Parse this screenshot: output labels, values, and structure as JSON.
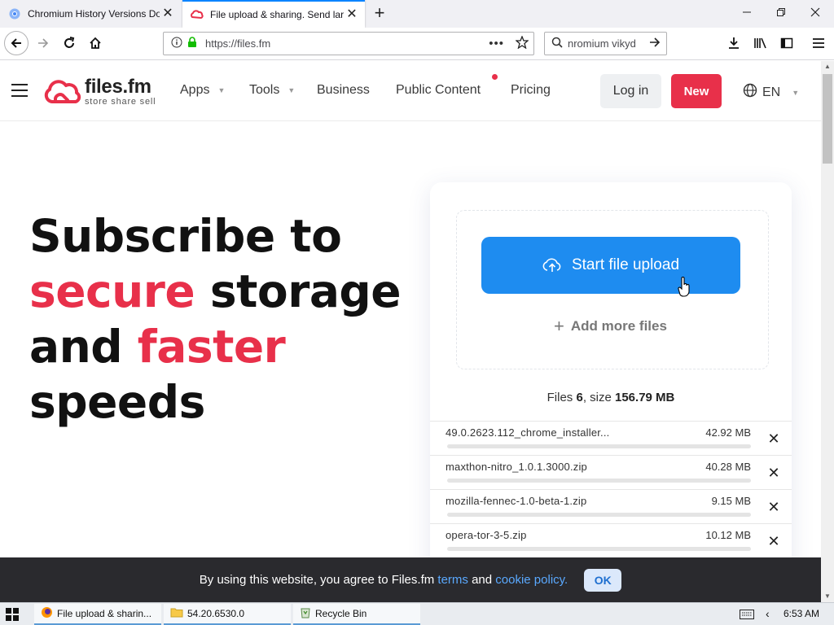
{
  "browser": {
    "tabs": [
      {
        "title": "Chromium History Versions Do"
      },
      {
        "title": "File upload & sharing. Send lar"
      }
    ],
    "url": "https://files.fm",
    "search_value": "nromium vikyd"
  },
  "site": {
    "logo_name": "files.fm",
    "logo_tagline": "store  share  sell",
    "nav": [
      {
        "label": "Apps"
      },
      {
        "label": "Tools"
      },
      {
        "label": "Business"
      },
      {
        "label": "Public Content"
      },
      {
        "label": "Pricing"
      }
    ],
    "login_label": "Log in",
    "new_label": "New",
    "language": "EN",
    "accent_color": "#e8304a",
    "primary_color": "#1e8cf0"
  },
  "hero": {
    "line1": "Subscribe to",
    "line2_highlight": "secure",
    "line2_rest": " storage",
    "line3_start": "and ",
    "line3_highlight": "faster",
    "line4": "speeds"
  },
  "upload": {
    "start_label": "Start file upload",
    "add_more_label": "Add more files",
    "summary_files_label": "Files",
    "summary_files_count": "6",
    "summary_size_label": ", size",
    "summary_size_value": "156.79 MB",
    "files": [
      {
        "name": "49.0.2623.112_chrome_installer...",
        "size": "42.92 MB",
        "progress": 0
      },
      {
        "name": "maxthon-nitro_1.0.1.3000.zip",
        "size": "40.28 MB",
        "progress": 0
      },
      {
        "name": "mozilla-fennec-1.0-beta-1.zip",
        "size": "9.15 MB",
        "progress": 0
      },
      {
        "name": "opera-tor-3-5.zip",
        "size": "10.12 MB",
        "progress": 0
      }
    ]
  },
  "cookie": {
    "text_before": "By using this website, you agree to Files.fm ",
    "terms_link": "terms",
    "text_and": " and ",
    "cookie_link": "cookie policy.",
    "ok_label": "OK"
  },
  "taskbar": {
    "items": [
      {
        "label": "File upload & sharin..."
      },
      {
        "label": "54.20.6530.0"
      },
      {
        "label": "Recycle Bin"
      }
    ],
    "clock": "6:53 AM"
  }
}
